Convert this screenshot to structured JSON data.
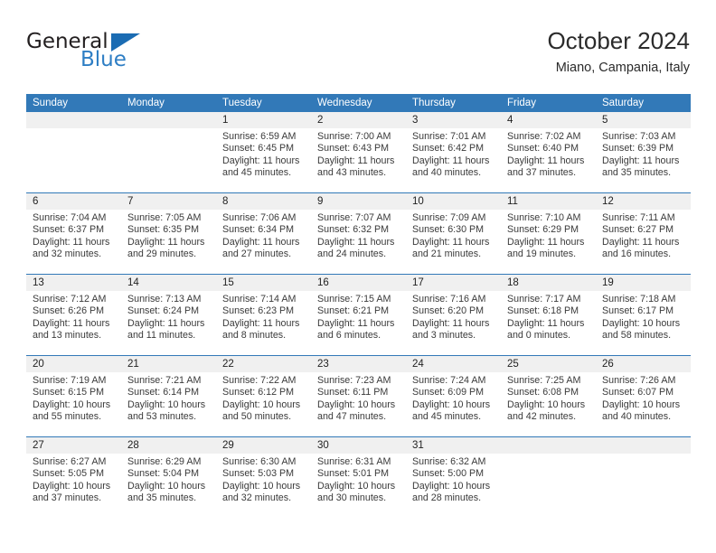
{
  "brand": {
    "word_general": "General",
    "word_blue": "Blue",
    "triangle_color": "#1b6cb3",
    "blue_text_color": "#2e7ec4"
  },
  "header": {
    "title": "October 2024",
    "subtitle": "Miano, Campania, Italy"
  },
  "theme": {
    "header_blue": "#3279b8",
    "daynum_band": "#f0f0f0",
    "text": "#222222"
  },
  "weekdays": [
    "Sunday",
    "Monday",
    "Tuesday",
    "Wednesday",
    "Thursday",
    "Friday",
    "Saturday"
  ],
  "weeks": [
    [
      {
        "day": ""
      },
      {
        "day": ""
      },
      {
        "day": "1",
        "sunrise": "Sunrise: 6:59 AM",
        "sunset": "Sunset: 6:45 PM",
        "daylight1": "Daylight: 11 hours",
        "daylight2": "and 45 minutes."
      },
      {
        "day": "2",
        "sunrise": "Sunrise: 7:00 AM",
        "sunset": "Sunset: 6:43 PM",
        "daylight1": "Daylight: 11 hours",
        "daylight2": "and 43 minutes."
      },
      {
        "day": "3",
        "sunrise": "Sunrise: 7:01 AM",
        "sunset": "Sunset: 6:42 PM",
        "daylight1": "Daylight: 11 hours",
        "daylight2": "and 40 minutes."
      },
      {
        "day": "4",
        "sunrise": "Sunrise: 7:02 AM",
        "sunset": "Sunset: 6:40 PM",
        "daylight1": "Daylight: 11 hours",
        "daylight2": "and 37 minutes."
      },
      {
        "day": "5",
        "sunrise": "Sunrise: 7:03 AM",
        "sunset": "Sunset: 6:39 PM",
        "daylight1": "Daylight: 11 hours",
        "daylight2": "and 35 minutes."
      }
    ],
    [
      {
        "day": "6",
        "sunrise": "Sunrise: 7:04 AM",
        "sunset": "Sunset: 6:37 PM",
        "daylight1": "Daylight: 11 hours",
        "daylight2": "and 32 minutes."
      },
      {
        "day": "7",
        "sunrise": "Sunrise: 7:05 AM",
        "sunset": "Sunset: 6:35 PM",
        "daylight1": "Daylight: 11 hours",
        "daylight2": "and 29 minutes."
      },
      {
        "day": "8",
        "sunrise": "Sunrise: 7:06 AM",
        "sunset": "Sunset: 6:34 PM",
        "daylight1": "Daylight: 11 hours",
        "daylight2": "and 27 minutes."
      },
      {
        "day": "9",
        "sunrise": "Sunrise: 7:07 AM",
        "sunset": "Sunset: 6:32 PM",
        "daylight1": "Daylight: 11 hours",
        "daylight2": "and 24 minutes."
      },
      {
        "day": "10",
        "sunrise": "Sunrise: 7:09 AM",
        "sunset": "Sunset: 6:30 PM",
        "daylight1": "Daylight: 11 hours",
        "daylight2": "and 21 minutes."
      },
      {
        "day": "11",
        "sunrise": "Sunrise: 7:10 AM",
        "sunset": "Sunset: 6:29 PM",
        "daylight1": "Daylight: 11 hours",
        "daylight2": "and 19 minutes."
      },
      {
        "day": "12",
        "sunrise": "Sunrise: 7:11 AM",
        "sunset": "Sunset: 6:27 PM",
        "daylight1": "Daylight: 11 hours",
        "daylight2": "and 16 minutes."
      }
    ],
    [
      {
        "day": "13",
        "sunrise": "Sunrise: 7:12 AM",
        "sunset": "Sunset: 6:26 PM",
        "daylight1": "Daylight: 11 hours",
        "daylight2": "and 13 minutes."
      },
      {
        "day": "14",
        "sunrise": "Sunrise: 7:13 AM",
        "sunset": "Sunset: 6:24 PM",
        "daylight1": "Daylight: 11 hours",
        "daylight2": "and 11 minutes."
      },
      {
        "day": "15",
        "sunrise": "Sunrise: 7:14 AM",
        "sunset": "Sunset: 6:23 PM",
        "daylight1": "Daylight: 11 hours",
        "daylight2": "and 8 minutes."
      },
      {
        "day": "16",
        "sunrise": "Sunrise: 7:15 AM",
        "sunset": "Sunset: 6:21 PM",
        "daylight1": "Daylight: 11 hours",
        "daylight2": "and 6 minutes."
      },
      {
        "day": "17",
        "sunrise": "Sunrise: 7:16 AM",
        "sunset": "Sunset: 6:20 PM",
        "daylight1": "Daylight: 11 hours",
        "daylight2": "and 3 minutes."
      },
      {
        "day": "18",
        "sunrise": "Sunrise: 7:17 AM",
        "sunset": "Sunset: 6:18 PM",
        "daylight1": "Daylight: 11 hours",
        "daylight2": "and 0 minutes."
      },
      {
        "day": "19",
        "sunrise": "Sunrise: 7:18 AM",
        "sunset": "Sunset: 6:17 PM",
        "daylight1": "Daylight: 10 hours",
        "daylight2": "and 58 minutes."
      }
    ],
    [
      {
        "day": "20",
        "sunrise": "Sunrise: 7:19 AM",
        "sunset": "Sunset: 6:15 PM",
        "daylight1": "Daylight: 10 hours",
        "daylight2": "and 55 minutes."
      },
      {
        "day": "21",
        "sunrise": "Sunrise: 7:21 AM",
        "sunset": "Sunset: 6:14 PM",
        "daylight1": "Daylight: 10 hours",
        "daylight2": "and 53 minutes."
      },
      {
        "day": "22",
        "sunrise": "Sunrise: 7:22 AM",
        "sunset": "Sunset: 6:12 PM",
        "daylight1": "Daylight: 10 hours",
        "daylight2": "and 50 minutes."
      },
      {
        "day": "23",
        "sunrise": "Sunrise: 7:23 AM",
        "sunset": "Sunset: 6:11 PM",
        "daylight1": "Daylight: 10 hours",
        "daylight2": "and 47 minutes."
      },
      {
        "day": "24",
        "sunrise": "Sunrise: 7:24 AM",
        "sunset": "Sunset: 6:09 PM",
        "daylight1": "Daylight: 10 hours",
        "daylight2": "and 45 minutes."
      },
      {
        "day": "25",
        "sunrise": "Sunrise: 7:25 AM",
        "sunset": "Sunset: 6:08 PM",
        "daylight1": "Daylight: 10 hours",
        "daylight2": "and 42 minutes."
      },
      {
        "day": "26",
        "sunrise": "Sunrise: 7:26 AM",
        "sunset": "Sunset: 6:07 PM",
        "daylight1": "Daylight: 10 hours",
        "daylight2": "and 40 minutes."
      }
    ],
    [
      {
        "day": "27",
        "sunrise": "Sunrise: 6:27 AM",
        "sunset": "Sunset: 5:05 PM",
        "daylight1": "Daylight: 10 hours",
        "daylight2": "and 37 minutes."
      },
      {
        "day": "28",
        "sunrise": "Sunrise: 6:29 AM",
        "sunset": "Sunset: 5:04 PM",
        "daylight1": "Daylight: 10 hours",
        "daylight2": "and 35 minutes."
      },
      {
        "day": "29",
        "sunrise": "Sunrise: 6:30 AM",
        "sunset": "Sunset: 5:03 PM",
        "daylight1": "Daylight: 10 hours",
        "daylight2": "and 32 minutes."
      },
      {
        "day": "30",
        "sunrise": "Sunrise: 6:31 AM",
        "sunset": "Sunset: 5:01 PM",
        "daylight1": "Daylight: 10 hours",
        "daylight2": "and 30 minutes."
      },
      {
        "day": "31",
        "sunrise": "Sunrise: 6:32 AM",
        "sunset": "Sunset: 5:00 PM",
        "daylight1": "Daylight: 10 hours",
        "daylight2": "and 28 minutes."
      },
      {
        "day": ""
      },
      {
        "day": ""
      }
    ]
  ]
}
